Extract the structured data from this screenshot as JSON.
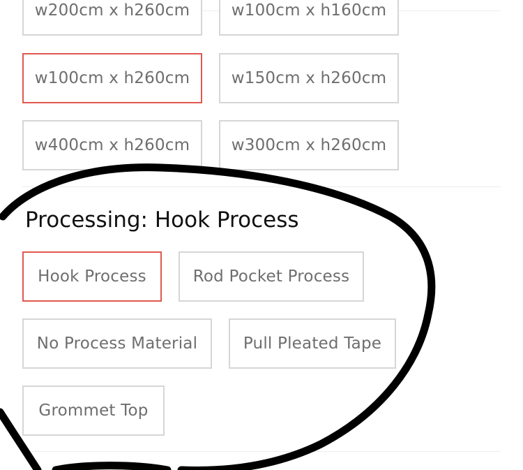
{
  "size_options": {
    "row1": [
      "w200cm x h260cm",
      "w100cm x h160cm"
    ],
    "row2": [
      "w100cm x h260cm",
      "w150cm x h260cm"
    ],
    "row3": [
      "w400cm x h260cm",
      "w300cm x h260cm"
    ],
    "selected": "w100cm x h260cm"
  },
  "processing": {
    "label": "Processing:",
    "selected_value": "Hook Process",
    "options": [
      "Hook Process",
      "Rod Pocket Process",
      "No Process Material",
      "Pull Pleated Tape",
      "Grommet Top"
    ]
  },
  "colors": {
    "selected_border": "#e0584f",
    "default_border": "#d6d6d6",
    "option_text": "#6e6e6e",
    "annotation_stroke": "#000000"
  }
}
